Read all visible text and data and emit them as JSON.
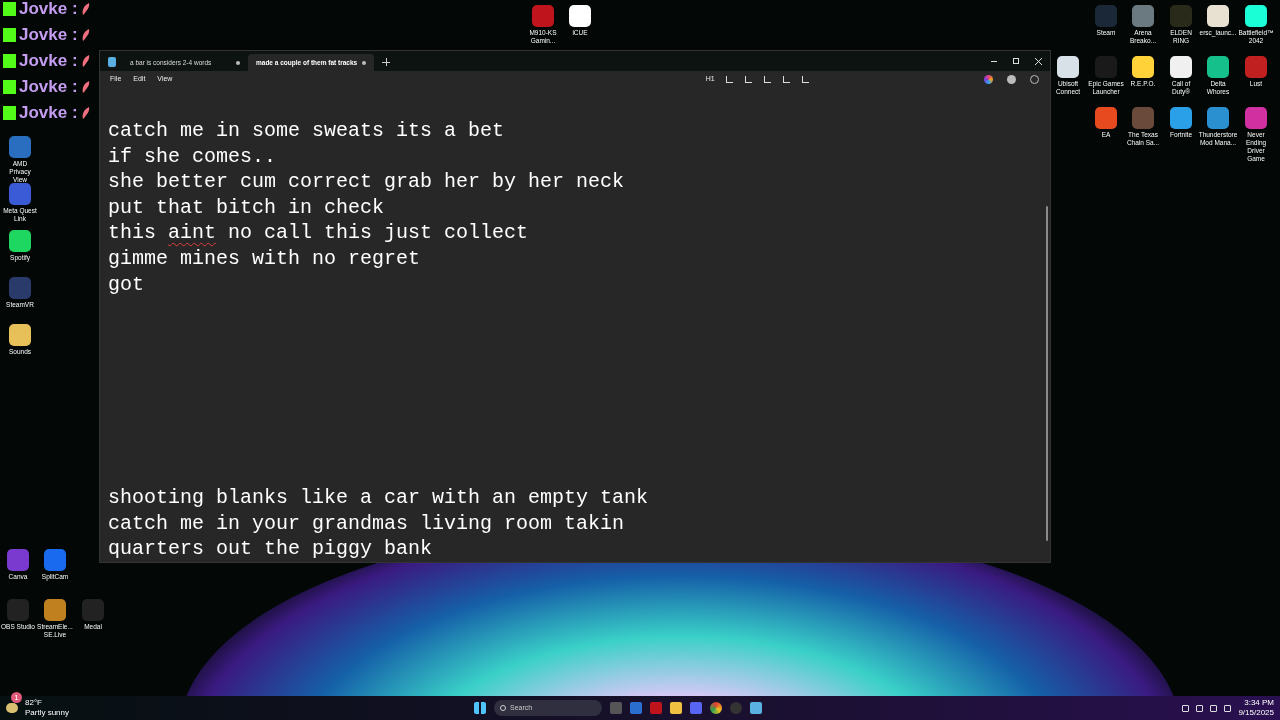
{
  "overlay": {
    "lines": [
      {
        "user": "Jovke :"
      },
      {
        "user": "Jovke :"
      },
      {
        "user": "Jovke :"
      },
      {
        "user": "Jovke :"
      },
      {
        "user": "Jovke :"
      }
    ]
  },
  "desktop": {
    "left_column": [
      {
        "label": "AMD Privacy View"
      },
      {
        "label": "Meta Quest Link"
      },
      {
        "label": "Spotify"
      },
      {
        "label": "SteamVR"
      },
      {
        "label": "Sounds"
      }
    ],
    "top_center": [
      {
        "label": "M910-KS Gamin..."
      },
      {
        "label": "iCUE"
      }
    ],
    "right_rows": [
      [
        {
          "label": "Steam"
        },
        {
          "label": "Arena Breako..."
        },
        {
          "label": "ELDEN RING"
        },
        {
          "label": "ersc_launc..."
        },
        {
          "label": "Battlefield™ 2042"
        }
      ],
      [
        {
          "label": "Ubisoft Connect"
        },
        {
          "label": "Epic Games Launcher"
        },
        {
          "label": "R.E.P.O."
        },
        {
          "label": "Call of Duty®"
        },
        {
          "label": "Delta Whores"
        },
        {
          "label": "Lust"
        }
      ],
      [
        {
          "label": "EA"
        },
        {
          "label": "The Texas Chain Sa..."
        },
        {
          "label": "Fortnite"
        },
        {
          "label": "Thunderstore Mod Mana..."
        },
        {
          "label": "Never Ending Driver Game"
        }
      ]
    ],
    "bottom_rows": [
      [
        {
          "label": "Canva"
        },
        {
          "label": "SplitCam"
        }
      ],
      [
        {
          "label": "OBS Studio"
        },
        {
          "label": "StreamEle... SE.Live"
        },
        {
          "label": "Medal"
        }
      ]
    ]
  },
  "notepad": {
    "tabs": [
      {
        "title": "a bar is considers 2-4 words",
        "selected": false
      },
      {
        "title": "made a couple of them fat tracks",
        "selected": true
      }
    ],
    "menu": [
      "File",
      "Edit",
      "View"
    ],
    "heading_button": "H1",
    "blocks": [
      {
        "lines": [
          [
            {
              "text": "catch me in some sweats its a bet"
            }
          ],
          [
            {
              "text": "if she comes.."
            }
          ],
          [
            {
              "text": "she better cum correct grab her by her neck"
            }
          ],
          [
            {
              "text": "put that bitch in check"
            }
          ],
          [
            {
              "text": "this "
            },
            {
              "text": "aint",
              "misspelled": true
            },
            {
              "text": " no call this just collect"
            }
          ],
          [
            {
              "text": "gimme mines with no regret"
            }
          ],
          [
            {
              "text": "got"
            }
          ]
        ]
      },
      {
        "lines": [
          [
            {
              "text": "shooting blanks like a car with an empty tank"
            }
          ],
          [
            {
              "text": "catch me in your grandmas living room takin"
            }
          ],
          [
            {
              "text": "quarters out the piggy bank"
            }
          ]
        ]
      }
    ]
  },
  "taskbar": {
    "weather": {
      "badge": "1",
      "temperature": "82°F",
      "condition": "Partly sunny"
    },
    "search_placeholder": "Search",
    "time": "3:34 PM",
    "date": "9/15/2025"
  }
}
